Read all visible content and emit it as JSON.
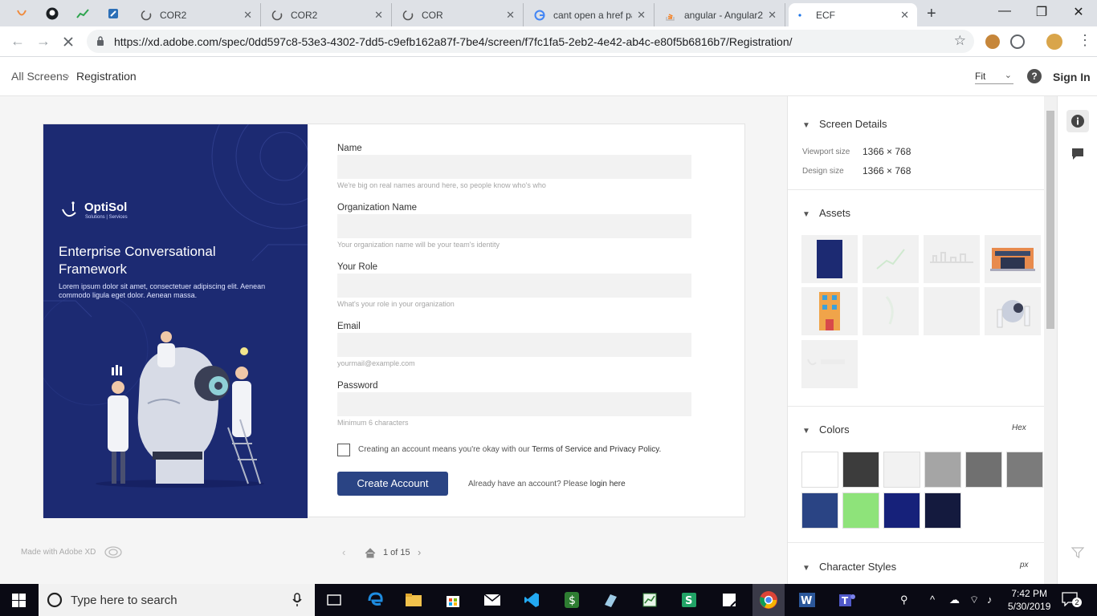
{
  "browser": {
    "tabs": [
      {
        "label": "",
        "pinned": true
      },
      {
        "label": "",
        "pinned": true
      },
      {
        "label": "",
        "pinned": true
      },
      {
        "label": "",
        "pinned": true
      },
      {
        "label": "COR2"
      },
      {
        "label": "COR2"
      },
      {
        "label": "COR"
      },
      {
        "label": "cant open a href pa"
      },
      {
        "label": "angular - Angular2"
      },
      {
        "label": "ECF",
        "active": true
      }
    ],
    "url": "https://xd.adobe.com/spec/0dd597c8-53e3-4302-7dd5-c9efb162a87f-7be4/screen/f7fc1fa5-2eb2-4e42-ab4c-e80f5b6816b7/Registration/"
  },
  "xd": {
    "breadcrumb_root": "All Screens",
    "breadcrumb_current": "Registration",
    "zoom": "Fit",
    "sign_in": "Sign In",
    "made_with": "Made with Adobe XD",
    "page_indicator": "1 of 15"
  },
  "artboard": {
    "logo_name": "OptiSol",
    "logo_tagline": "Solutions  |  Services",
    "hero_title": "Enterprise Conversational Framework",
    "hero_desc": "Lorem ipsum dolor sit amet, consectetuer adipiscing elit. Aenean commodo ligula eget dolor. Aenean massa.",
    "fields": [
      {
        "label": "Name",
        "hint": "We're big on real names around here, so people know who's who"
      },
      {
        "label": "Organization Name",
        "hint": "Your organization name will be your team's identity"
      },
      {
        "label": "Your Role",
        "hint": "What's your role in your organization"
      },
      {
        "label": "Email",
        "hint": "yourmail@example.com"
      },
      {
        "label": "Password",
        "hint": "Minimum 6 characters"
      }
    ],
    "terms_prefix": "Creating an account means you're okay with our ",
    "terms_link": "Terms of Service and Privacy Policy.",
    "create_button": "Create Account",
    "login_prefix": "Already have an account? Please ",
    "login_link": "login here"
  },
  "panel": {
    "screen_details_title": "Screen Details",
    "viewport_label": "Viewport size",
    "viewport_value": "1366 × 768",
    "design_label": "Design size",
    "design_value": "1366 × 768",
    "assets_title": "Assets",
    "colors_title": "Colors",
    "colors_format": "Hex",
    "colors": [
      "#FFFFFF",
      "#3C3C3C",
      "#F2F2F2",
      "#A5A5A5",
      "#707070",
      "#7B7B7B",
      "#2A4484",
      "#8EE37A",
      "#16217A",
      "#141A3E"
    ],
    "character_styles_title": "Character Styles",
    "character_units": "px"
  },
  "taskbar": {
    "search_placeholder": "Type here to search",
    "time": "7:42 PM",
    "date": "5/30/2019",
    "notifications": "2"
  }
}
